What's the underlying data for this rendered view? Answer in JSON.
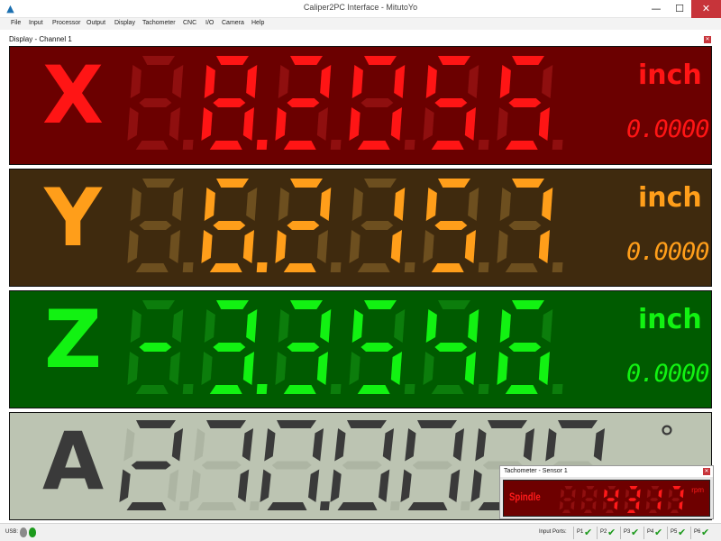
{
  "window": {
    "title": "Caliper2PC Interface - MitutoYo"
  },
  "menu": [
    "File",
    "Input",
    "Processor",
    "Output",
    "Display",
    "Tachometer",
    "CNC",
    "I/O",
    "Camera",
    "Help"
  ],
  "panel": {
    "title": "Display - Channel 1"
  },
  "axes": [
    {
      "letter": "X",
      "value": "8.2055",
      "unit": "inch",
      "secondary": "0.0000",
      "bg": "#6b0000",
      "color": "#ff1515",
      "dim": "#8f0f0f"
    },
    {
      "letter": "Y",
      "value": "6.2157",
      "unit": "inch",
      "secondary": "0.0000",
      "bg": "#3f2a0e",
      "color": "#ff9e1a",
      "dim": "#6d4f1f"
    },
    {
      "letter": "Z",
      "value": "-3.3546",
      "unit": "inch",
      "secondary": "0.0000",
      "bg": "#005b00",
      "color": "#12f212",
      "dim": "#0c7d0c"
    },
    {
      "letter": "A",
      "value": "270.0000",
      "unit": "°",
      "secondary": "",
      "bg": "#bcc4b2",
      "color": "#3a3a3a",
      "dim": "#adb5a3"
    }
  ],
  "tachometer": {
    "title": "Tachometer - Sensor 1",
    "label": "Spindle",
    "value": "4317",
    "unit": "rpm",
    "color": "#ff1a1a",
    "dim": "#8f0f0f"
  },
  "status": {
    "usb_label": "USB:",
    "input_ports_label": "Input Ports:",
    "ports": [
      "P1",
      "P2",
      "P3",
      "P4",
      "P5",
      "P6"
    ]
  }
}
